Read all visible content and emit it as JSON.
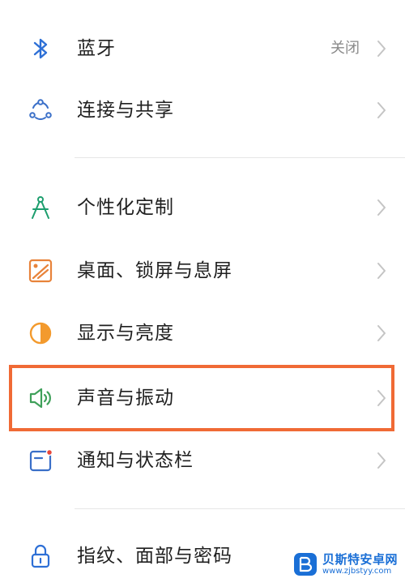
{
  "settings": {
    "items": [
      {
        "label": "蓝牙",
        "value": "关闭",
        "icon": "bluetooth-icon"
      },
      {
        "label": "连接与共享",
        "icon": "connection-sharing-icon"
      },
      {
        "label": "个性化定制",
        "icon": "personalization-icon"
      },
      {
        "label": "桌面、锁屏与息屏",
        "icon": "wallpaper-icon"
      },
      {
        "label": "显示与亮度",
        "icon": "display-brightness-icon"
      },
      {
        "label": "声音与振动",
        "icon": "sound-vibration-icon"
      },
      {
        "label": "通知与状态栏",
        "icon": "notification-statusbar-icon"
      },
      {
        "label": "指纹、面部与密码",
        "icon": "lock-icon"
      }
    ],
    "highlighted_item": "声音与振动"
  },
  "watermark": {
    "title": "贝斯特安卓网",
    "url": "www.zjbstyy.com"
  },
  "colors": {
    "highlight_border": "#f06a35",
    "bluetooth": "#2d6fd6",
    "personalization": "#1d9e6e",
    "wallpaper": "#e8833a",
    "display": "#f39a2d",
    "sound": "#3fa05a",
    "notification": "#3a6fc8",
    "lock": "#2d6fd6",
    "watermark": "#1a6fd6"
  }
}
